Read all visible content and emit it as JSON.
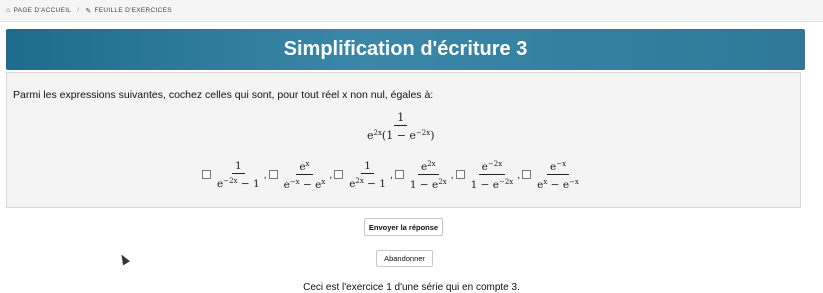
{
  "breadcrumb": {
    "home_icon": "home-icon",
    "home": "PAGE D'ACCUEIL",
    "separator": "/",
    "edit_icon": "edit-icon",
    "current": "FEUILLE D'EXERCICES"
  },
  "title": "Simplification d'écriture 3",
  "question": "Parmi les expressions suivantes, cochez celles qui sont, pour tout réel x non nul, égales à:",
  "main_expression": {
    "numerator": "1",
    "denominator": "e^{2x}(1 − e^{−2x})"
  },
  "options": [
    {
      "numerator": "1",
      "denominator": "e^{−2x} − 1",
      "checked": false
    },
    {
      "numerator": "e^{x}",
      "denominator": "e^{−x} − e^{x}",
      "checked": false
    },
    {
      "numerator": "1",
      "denominator": "e^{2x} − 1",
      "checked": false
    },
    {
      "numerator": "e^{2x}",
      "denominator": "1 − e^{2x}",
      "checked": false
    },
    {
      "numerator": "e^{−2x}",
      "denominator": "1 − e^{−2x}",
      "checked": false
    },
    {
      "numerator": "e^{−x}",
      "denominator": "e^{x} − e^{−x}",
      "checked": false
    }
  ],
  "buttons": {
    "submit": "Envoyer la réponse",
    "abandon": "Abandonner"
  },
  "footer": "Ceci est l'exercice 1 d'une série qui en compte 3.",
  "colors": {
    "title_start": "#1e6c8b",
    "title_end": "#2f7898",
    "panel_bg": "#f4f4f4"
  }
}
